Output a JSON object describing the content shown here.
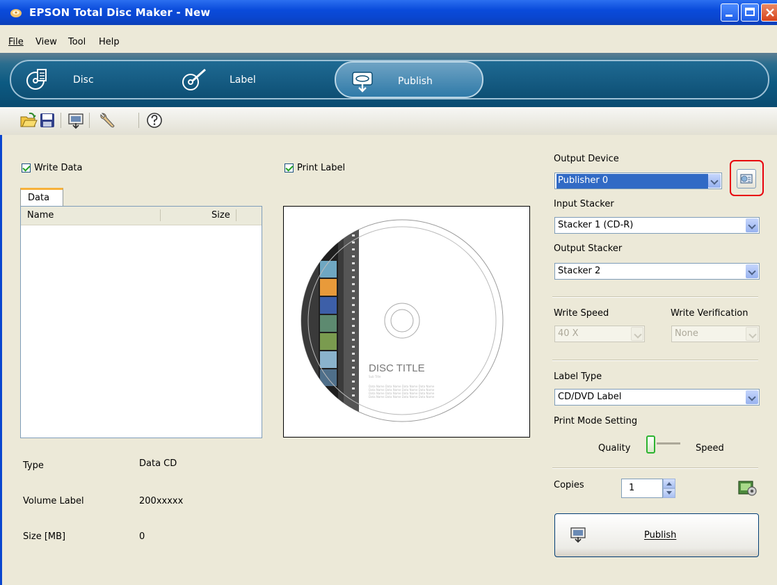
{
  "window": {
    "title": "EPSON Total Disc Maker - New"
  },
  "menu": [
    "File",
    "View",
    "Tool",
    "Help"
  ],
  "nav": {
    "disc": "Disc",
    "label": "Label",
    "publish": "Publish",
    "active": "Publish"
  },
  "toolbar": {
    "icons": [
      "open-folder-icon",
      "save-icon",
      "publish-icon",
      "settings-icon",
      "help-icon"
    ]
  },
  "left": {
    "write_data": "Write Data",
    "tab": "Data",
    "columns": {
      "name": "Name",
      "size": "Size"
    },
    "info": [
      {
        "label": "Type",
        "value": "Data CD"
      },
      {
        "label": "Volume Label",
        "value": "200xxxxx"
      },
      {
        "label": "Size [MB]",
        "value": "0"
      }
    ]
  },
  "center": {
    "print_label": "Print Label",
    "disc_title": "DISC TITLE",
    "disc_subtitle": "Sub Title",
    "disc_body": "Data Name Data Name Data Name Data Name"
  },
  "right": {
    "output_device": {
      "label": "Output Device",
      "value": "Publisher 0"
    },
    "input_stacker": {
      "label": "Input Stacker",
      "value": "Stacker 1 (CD-R)"
    },
    "output_stacker": {
      "label": "Output Stacker",
      "value": "Stacker 2"
    },
    "write_speed": {
      "label": "Write Speed",
      "value": "40 X"
    },
    "write_verification": {
      "label": "Write Verification",
      "value": "None"
    },
    "label_type": {
      "label": "Label Type",
      "value": "CD/DVD Label"
    },
    "print_mode": {
      "label": "Print Mode Setting",
      "left": "Quality",
      "right": "Speed",
      "level": 0
    },
    "copies": {
      "label": "Copies",
      "value": "1"
    },
    "publish_button": "Publish"
  },
  "colors": {
    "accent_highlight": "#e8000c",
    "titlebar": "#0a46cf",
    "banner": "#0c5a82"
  }
}
